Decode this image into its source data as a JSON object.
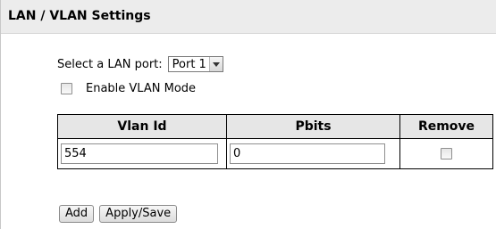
{
  "header": {
    "title": "LAN / VLAN Settings"
  },
  "port": {
    "label": "Select a LAN port:",
    "selected": "Port 1"
  },
  "vlan_mode": {
    "label": "Enable VLAN Mode",
    "checked": false
  },
  "table": {
    "columns": [
      "Vlan Id",
      "Pbits",
      "Remove"
    ],
    "rows": [
      {
        "vlan_id": "554",
        "pbits": "0",
        "remove": false
      }
    ]
  },
  "buttons": {
    "add": "Add",
    "apply_save": "Apply/Save"
  }
}
